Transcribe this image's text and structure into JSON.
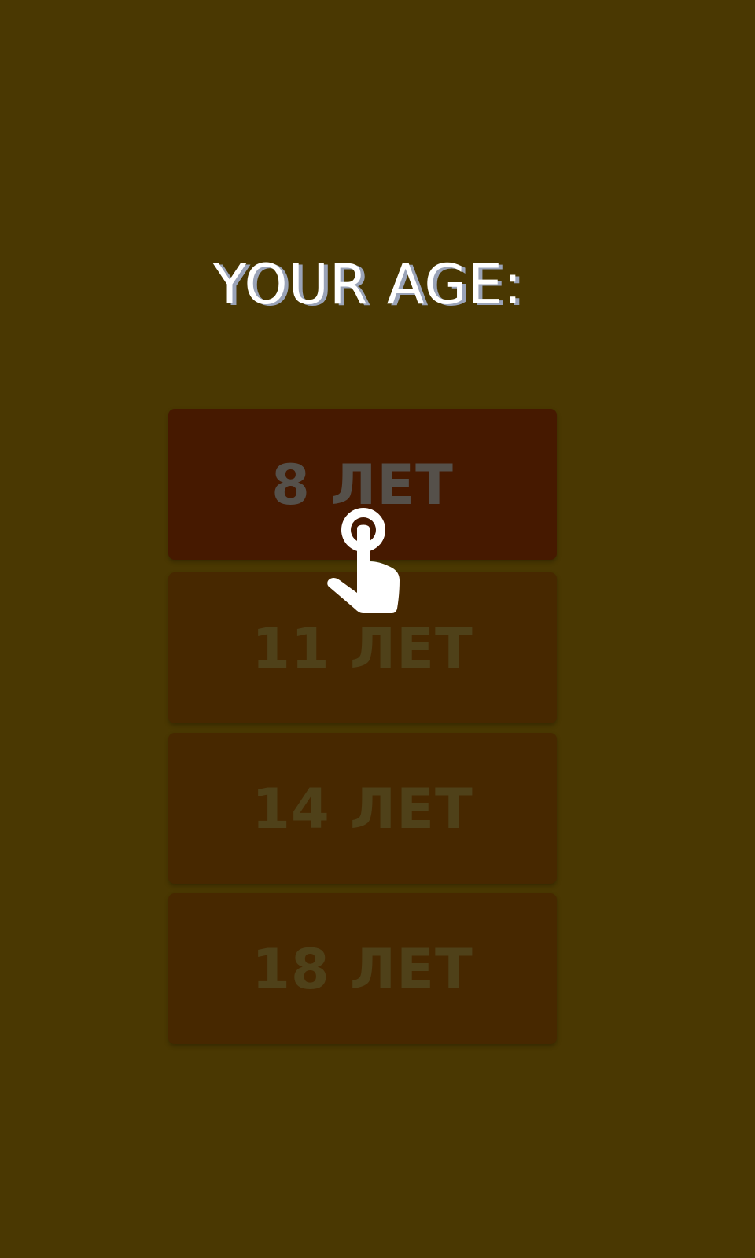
{
  "screen": {
    "title": "YOUR AGE:",
    "background": "#4a3802"
  },
  "age_options": [
    {
      "label": "8 ЛЕТ",
      "bg": "#461900",
      "text_color": "#55504a"
    },
    {
      "label": "11 ЛЕТ",
      "bg": "#472800",
      "text_color": "#4f4119"
    },
    {
      "label": "14 ЛЕТ",
      "bg": "#472800",
      "text_color": "#4f4119"
    },
    {
      "label": "18 ЛЕТ",
      "bg": "#472800",
      "text_color": "#4f4119"
    }
  ],
  "hint": {
    "icon": "tap-hand-icon"
  }
}
